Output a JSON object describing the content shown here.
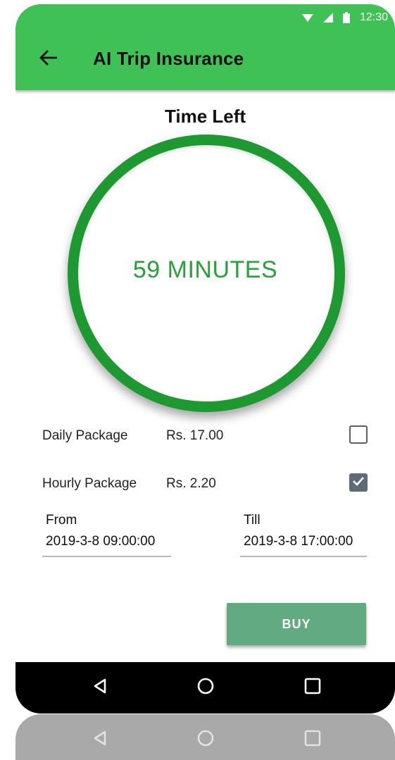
{
  "status_bar": {
    "time": "12:30",
    "icons": [
      "wifi-icon",
      "signal-icon",
      "battery-icon"
    ]
  },
  "appbar": {
    "title": "AI Trip Insurance",
    "back_icon": "arrow-left-icon",
    "color": "#40c156"
  },
  "timer": {
    "title": "Time Left",
    "value": "59 MINUTES",
    "ring_color": "#1e9830",
    "text_color": "#29a03a"
  },
  "packages": [
    {
      "name": "Daily Package",
      "price": "Rs. 17.00",
      "checked": false
    },
    {
      "name": "Hourly Package",
      "price": "Rs. 2.20",
      "checked": true
    }
  ],
  "from_field": {
    "label": "From",
    "value": "2019-3-8 09:00:00"
  },
  "till_field": {
    "label": "Till",
    "value": "2019-3-8 17:00:00"
  },
  "buy_button": {
    "label": "BUY",
    "color": "#62ab82"
  },
  "navbar": {
    "icons": [
      "back-triangle-icon",
      "home-circle-icon",
      "recents-square-icon"
    ]
  }
}
